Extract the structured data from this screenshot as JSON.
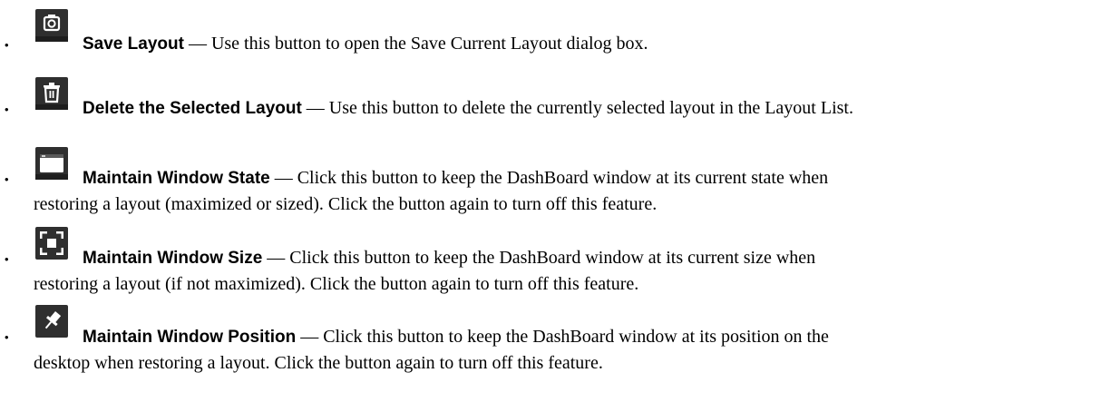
{
  "items": [
    {
      "icon": "camera-icon",
      "name": "Save Layout",
      "desc": " — Use this button to open the Save Current Layout dialog box."
    },
    {
      "icon": "trash-icon",
      "name": "Delete the Selected Layout",
      "desc": " — Use this button to delete the currently selected layout in the Layout List."
    },
    {
      "icon": "window-icon",
      "name": "Maintain Window State",
      "desc": " — Click this button to keep the DashBoard window at its current state when",
      "desc2": "restoring a layout (maximized or sized). Click the button again to turn off this feature."
    },
    {
      "icon": "resize-corners-icon",
      "name": "Maintain Window Size",
      "desc": " — Click this button to keep the DashBoard window at its current size when",
      "desc2": "restoring a layout (if not maximized). Click the button again to turn off this feature."
    },
    {
      "icon": "pin-icon",
      "name": "Maintain Window Position",
      "desc": " — Click this button to keep the DashBoard window at its position on the",
      "desc2": "desktop when restoring a layout. Click the button again to turn off this feature."
    }
  ],
  "bullet": "•"
}
